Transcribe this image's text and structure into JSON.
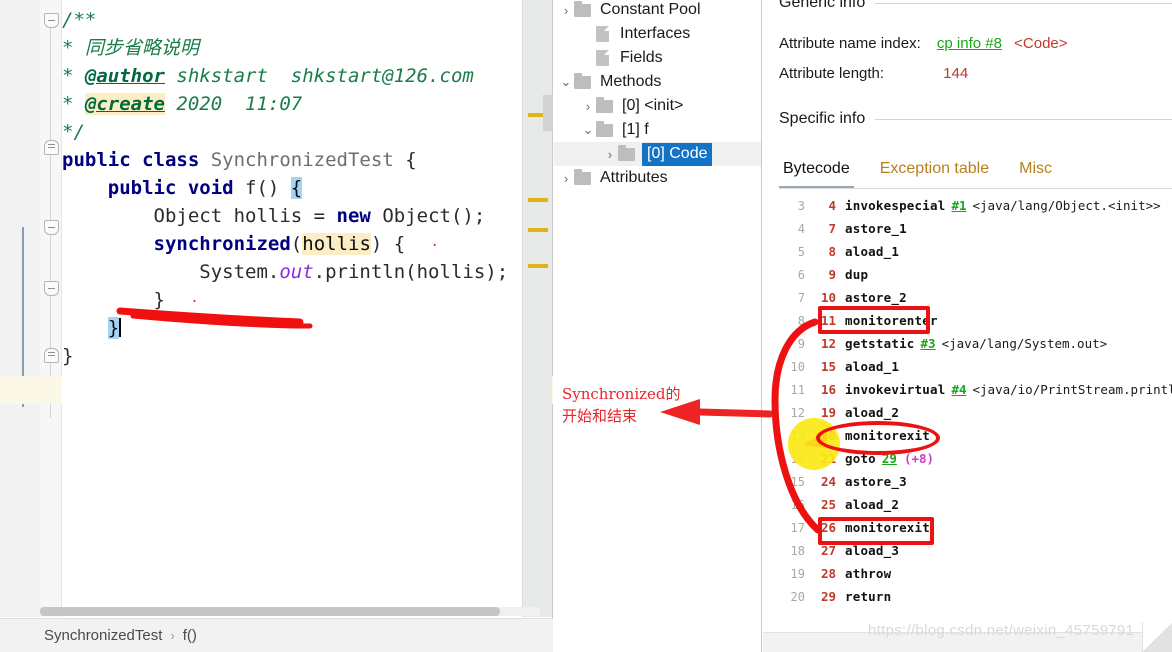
{
  "editor": {
    "lines": [
      {
        "indent": 0,
        "parts": [
          {
            "t": "/**",
            "c": "cmt"
          }
        ]
      },
      {
        "indent": 1,
        "parts": [
          {
            "t": "* ",
            "c": "cmt"
          },
          {
            "t": "同步省略说明",
            "c": "cmt"
          }
        ]
      },
      {
        "indent": 1,
        "parts": [
          {
            "t": "* ",
            "c": "cmt"
          },
          {
            "t": "@author",
            "c": "cmt-tag"
          },
          {
            "t": " shkstart  shkstart@126.com",
            "c": "cmt"
          }
        ]
      },
      {
        "indent": 1,
        "parts": [
          {
            "t": "* ",
            "c": "cmt"
          },
          {
            "t": "@create",
            "c": "cmt-tag-hl"
          },
          {
            "t": " 2020  11:07",
            "c": "cmt"
          }
        ]
      },
      {
        "indent": 1,
        "parts": [
          {
            "t": "*/",
            "c": "cmt"
          }
        ]
      },
      {
        "indent": 0,
        "parts": [
          {
            "t": "public class ",
            "c": "kw"
          },
          {
            "t": "SynchronizedTest",
            "c": "cls"
          },
          {
            "t": " {",
            "c": "ident"
          }
        ]
      },
      {
        "indent": 0,
        "parts": [
          {
            "t": "    public void ",
            "c": "kw"
          },
          {
            "t": "f() ",
            "c": "ident"
          },
          {
            "t": "{",
            "c": "sel-brace"
          }
        ]
      },
      {
        "indent": 0,
        "parts": [
          {
            "t": "        Object hollis = ",
            "c": "ident"
          },
          {
            "t": "new",
            "c": "kw"
          },
          {
            "t": " Object();",
            "c": "ident"
          }
        ]
      },
      {
        "indent": 0,
        "parts": [
          {
            "t": "        ",
            "c": "ident"
          },
          {
            "t": "synchronized",
            "c": "kw"
          },
          {
            "t": "(",
            "c": "ident"
          },
          {
            "t": "hollis",
            "c": "hl-ident"
          },
          {
            "t": ") {",
            "c": "ident"
          }
        ]
      },
      {
        "indent": 0,
        "parts": [
          {
            "t": "            System.",
            "c": "ident"
          },
          {
            "t": "out",
            "c": "fld"
          },
          {
            "t": ".println(hollis);",
            "c": "ident"
          }
        ]
      },
      {
        "indent": 0,
        "parts": [
          {
            "t": "        }",
            "c": "ident"
          }
        ]
      },
      {
        "indent": 0,
        "parts": [
          {
            "t": "    ",
            "c": "ident"
          },
          {
            "t": "}",
            "c": "sel-brace"
          }
        ]
      },
      {
        "indent": 0,
        "parts": [
          {
            "t": "}",
            "c": "ident"
          }
        ]
      }
    ],
    "breadcrumb": {
      "class_name": "SynchronizedTest",
      "separator": "›",
      "method_name": "f()"
    }
  },
  "tree": {
    "items": [
      {
        "twisty": "chevron-right",
        "icon": "folder",
        "label": "Constant Pool",
        "indent": 0,
        "selected": false
      },
      {
        "twisty": "",
        "icon": "file",
        "label": "Interfaces",
        "indent": 1,
        "selected": false
      },
      {
        "twisty": "",
        "icon": "file",
        "label": "Fields",
        "indent": 1,
        "selected": false
      },
      {
        "twisty": "chevron-down",
        "icon": "folder",
        "label": "Methods",
        "indent": 0,
        "selected": false
      },
      {
        "twisty": "chevron-right",
        "icon": "folder",
        "label": "[0] <init>",
        "indent": 1,
        "selected": false
      },
      {
        "twisty": "chevron-down",
        "icon": "folder",
        "label": "[1] f",
        "indent": 1,
        "selected": false
      },
      {
        "twisty": "chevron-right",
        "icon": "folder",
        "label": "[0] Code",
        "indent": 2,
        "selected": true
      },
      {
        "twisty": "chevron-right",
        "icon": "folder",
        "label": "Attributes",
        "indent": 0,
        "selected": false
      }
    ]
  },
  "detail": {
    "generic_info_title": "Generic info",
    "specific_info_title": "Specific info",
    "attribute_name_index_label": "Attribute name index:",
    "attribute_name_index_link": "cp info #8",
    "attribute_name_index_tag": "<Code>",
    "attribute_length_label": "Attribute length:",
    "attribute_length_value": "144",
    "tabs": [
      {
        "label": "Bytecode",
        "active": true
      },
      {
        "label": "Exception table",
        "active": false
      },
      {
        "label": "Misc",
        "active": false
      }
    ],
    "bytecode": [
      {
        "line": "3",
        "offset": "4",
        "op": "invokespecial",
        "ref": "#1",
        "desc": "<java/lang/Object.<init>>",
        "delta": ""
      },
      {
        "line": "4",
        "offset": "7",
        "op": "astore_1",
        "ref": "",
        "desc": "",
        "delta": ""
      },
      {
        "line": "5",
        "offset": "8",
        "op": "aload_1",
        "ref": "",
        "desc": "",
        "delta": ""
      },
      {
        "line": "6",
        "offset": "9",
        "op": "dup",
        "ref": "",
        "desc": "",
        "delta": ""
      },
      {
        "line": "7",
        "offset": "10",
        "op": "astore_2",
        "ref": "",
        "desc": "",
        "delta": ""
      },
      {
        "line": "8",
        "offset": "11",
        "op": "monitorenter",
        "ref": "",
        "desc": "",
        "delta": ""
      },
      {
        "line": "9",
        "offset": "12",
        "op": "getstatic",
        "ref": "#3",
        "desc": "<java/lang/System.out>",
        "delta": ""
      },
      {
        "line": "10",
        "offset": "15",
        "op": "aload_1",
        "ref": "",
        "desc": "",
        "delta": ""
      },
      {
        "line": "11",
        "offset": "16",
        "op": "invokevirtual",
        "ref": "#4",
        "desc": "<java/io/PrintStream.println>",
        "delta": ""
      },
      {
        "line": "12",
        "offset": "19",
        "op": "aload_2",
        "ref": "",
        "desc": "",
        "delta": ""
      },
      {
        "line": "13",
        "offset": "20",
        "op": "monitorexit",
        "ref": "",
        "desc": "",
        "delta": ""
      },
      {
        "line": "14",
        "offset": "21",
        "op": "goto",
        "ref": "29",
        "desc": "",
        "delta": "(+8)"
      },
      {
        "line": "15",
        "offset": "24",
        "op": "astore_3",
        "ref": "",
        "desc": "",
        "delta": ""
      },
      {
        "line": "16",
        "offset": "25",
        "op": "aload_2",
        "ref": "",
        "desc": "",
        "delta": ""
      },
      {
        "line": "17",
        "offset": "26",
        "op": "monitorexit",
        "ref": "",
        "desc": "",
        "delta": ""
      },
      {
        "line": "18",
        "offset": "27",
        "op": "aload_3",
        "ref": "",
        "desc": "",
        "delta": ""
      },
      {
        "line": "19",
        "offset": "28",
        "op": "athrow",
        "ref": "",
        "desc": "",
        "delta": ""
      },
      {
        "line": "20",
        "offset": "29",
        "op": "return",
        "ref": "",
        "desc": "",
        "delta": ""
      }
    ]
  },
  "annotation": {
    "text_line1": "Synchronized的",
    "text_line2": "开始和结束",
    "color": "#e8252a",
    "highlight_color": "#fbe816"
  },
  "watermark": {
    "text": "https://blog.csdn.net/weixin_45759791"
  }
}
